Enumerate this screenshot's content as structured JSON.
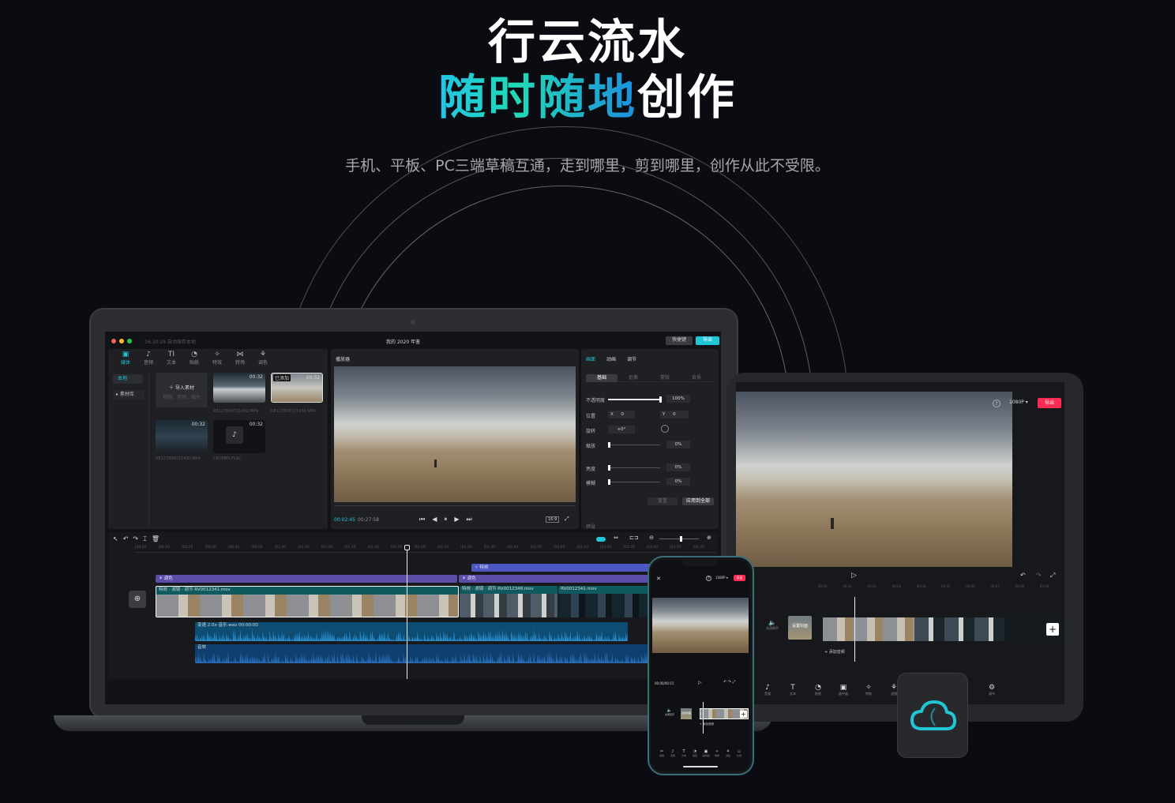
{
  "headline": {
    "line1": "行云流水",
    "line2_highlight": "随时随地",
    "line2_rest": "创作"
  },
  "subtitle": "手机、平板、PC三端草稿互通，走到哪里，剪到哪里，创作从此不受限。",
  "colors": {
    "accent": "#21c6d6",
    "export_red": "#fe2c55",
    "background": "#0b0c12"
  },
  "laptop": {
    "titlebar": {
      "status": "16:30:29 自动保存本地",
      "title": "我的 2020 年鉴",
      "shortcut_label": "快捷键",
      "export_label": "导出"
    },
    "media_tabs": [
      {
        "label": "媒体",
        "icon": "media-icon"
      },
      {
        "label": "音频",
        "icon": "audio-icon"
      },
      {
        "label": "文本",
        "icon": "text-icon"
      },
      {
        "label": "贴纸",
        "icon": "sticker-icon"
      },
      {
        "label": "特效",
        "icon": "effects-icon"
      },
      {
        "label": "转场",
        "icon": "transition-icon"
      },
      {
        "label": "调色",
        "icon": "color-icon"
      }
    ],
    "side_nav": {
      "local": "本地",
      "library": "▸ 素材库"
    },
    "import": {
      "label": "导入素材",
      "hint": "视频、音频、图片"
    },
    "clips": [
      {
        "duration": "00:32",
        "name": "RE127809721432.MP4",
        "tag": ""
      },
      {
        "duration": "00:32",
        "name": "RE127809721432.MP4",
        "tag": "已添加"
      },
      {
        "duration": "00:32",
        "name": "RE127809721432.MP4",
        "tag": ""
      },
      {
        "duration": "00:32",
        "name": "CRUMBS.FLAC",
        "tag": ""
      }
    ],
    "player": {
      "title": "播放器",
      "current_time": "00:02:45",
      "total_time": "00:27:58",
      "ratio": "16:9"
    },
    "inspector": {
      "tabs": [
        "画面",
        "动画",
        "调节"
      ],
      "subtabs": [
        "基础",
        "抠像",
        "蒙版",
        "背景"
      ],
      "rows": [
        {
          "label": "不透明度",
          "value": "100%"
        },
        {
          "label": "位置",
          "x": "0",
          "y": "0"
        },
        {
          "label": "旋转",
          "value": "+0°"
        },
        {
          "label": "缩放",
          "value": "0%"
        },
        {
          "label": "亮度",
          "value": "0%"
        },
        {
          "label": "模糊",
          "value": "0%"
        }
      ],
      "reset_label": "重置",
      "apply_all_label": "应用到全部",
      "footer": "预设"
    },
    "timeline": {
      "ticks": [
        "00:00",
        "00:10",
        "00:20",
        "00:30",
        "00:40",
        "00:50",
        "01:00",
        "01:10",
        "01:20",
        "01:30",
        "01:40",
        "01:50",
        "02:00",
        "02:10",
        "02:20",
        "02:30",
        "02:40",
        "02:50",
        "03:00",
        "03:10",
        "03:20",
        "03:30",
        "03:40",
        "03:50",
        "04:00"
      ],
      "effect_track": "特效",
      "color_track_1": "调色",
      "color_track_2": "调色",
      "main_clip_labels": [
        "特效",
        "滤镜",
        "调节",
        "RV0012341.mov"
      ],
      "clip2_labels": [
        "特效",
        "滤镜",
        "调节",
        "RV0012348.mov"
      ],
      "clip3_label": "RV0012341.mov",
      "audio1": "变速 2.0x  音乐.wav  00:00:00",
      "audio2": "音效"
    }
  },
  "tablet": {
    "resolution": "1080P",
    "export_label": "导出",
    "ticks": [
      "00:00",
      "00:01",
      "00:02",
      "00:03",
      "00:04",
      "00:05",
      "00:06",
      "00:07",
      "00:08",
      "00:09"
    ],
    "side_labels": [
      "关闭原声",
      "设置封面"
    ],
    "add_audio": "+ 添加音频",
    "tools": [
      "音频",
      "文本",
      "贴纸",
      "画中画",
      "特效",
      "滤镜",
      "比例",
      "调节"
    ]
  },
  "phone": {
    "resolution": "1080P",
    "export_label": "导出",
    "time": "00:00/00:15",
    "side_labels": [
      "关闭原声",
      "设置封面"
    ],
    "add_audio": "+ 添加音频",
    "tools": [
      "剪辑",
      "音频",
      "文本",
      "贴纸",
      "画中画",
      "特效",
      "滤镜",
      "比例"
    ]
  },
  "cloud_badge": {
    "icon": "cloud-icon"
  }
}
